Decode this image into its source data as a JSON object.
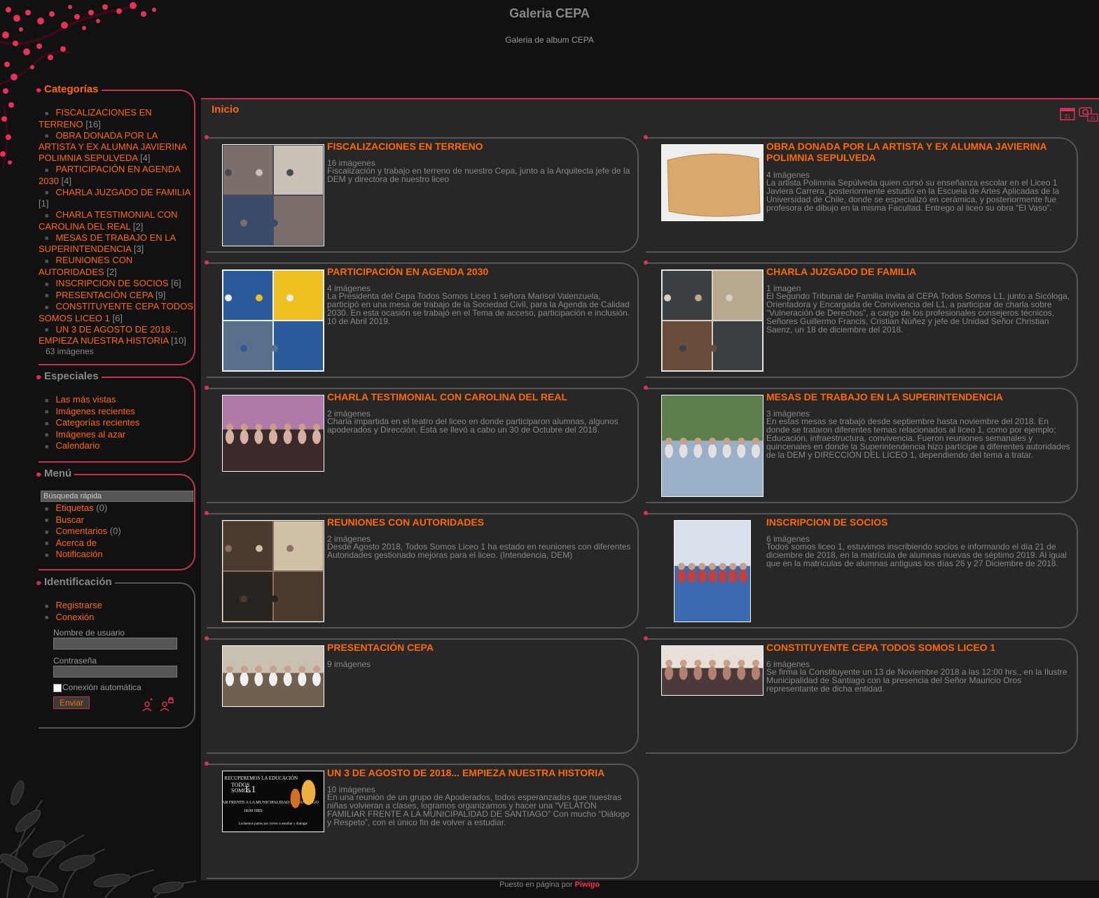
{
  "site": {
    "title": "Galeria CEPA",
    "subtitle": "Galeria de album CEPA"
  },
  "sidebar": {
    "categories": {
      "title": "Categorías",
      "items": [
        {
          "label": "FISCALIZACIONES EN TERRENO",
          "count": "[16]"
        },
        {
          "label": "OBRA DONADA POR LA ARTISTA Y EX ALUMNA JAVIERINA POLIMNIA SEPULVEDA",
          "count": "[4]"
        },
        {
          "label": "PARTICIPACIÓN EN AGENDA 2030",
          "count": "[4]"
        },
        {
          "label": "CHARLA JUZGADO DE FAMILIA",
          "count": "[1]"
        },
        {
          "label": "CHARLA TESTIMONIAL CON CAROLINA DEL REAL",
          "count": "[2]"
        },
        {
          "label": "MESAS DE TRABAJO EN LA SUPERINTENDENCIA",
          "count": "[3]"
        },
        {
          "label": "REUNIONES CON AUTORIDADES",
          "count": "[2]"
        },
        {
          "label": "INSCRIPCION DE SOCIOS",
          "count": "[6]"
        },
        {
          "label": "PRESENTACIÓN CEPA",
          "count": "[9]"
        },
        {
          "label": "CONSTITUYENTE CEPA TODOS SOMOS LICEO 1",
          "count": "[6]"
        },
        {
          "label": "UN 3 DE AGOSTO DE 2018... EMPIEZA NUESTRA HISTORIA",
          "count": "[10]"
        }
      ],
      "total": "63 imágenes"
    },
    "specials": {
      "title": "Especiales",
      "items": [
        "Las más vistas",
        "Imágenes recientes",
        "Categorías recientes",
        "Imágenes al azar",
        "Calendario"
      ]
    },
    "menu": {
      "title": "Menú",
      "search_placeholder": "Búsqueda rápida",
      "items": [
        {
          "label": "Etiquetas",
          "count": "(0)"
        },
        {
          "label": "Buscar",
          "count": ""
        },
        {
          "label": "Comentarios",
          "count": "(0)"
        },
        {
          "label": "Acerca de",
          "count": ""
        },
        {
          "label": "Notificación",
          "count": ""
        }
      ]
    },
    "identification": {
      "title": "Identificación",
      "items": [
        "Registrarse",
        "Conexión"
      ],
      "username_label": "Nombre de usuario",
      "password_label": "Contraseña",
      "remember_label": "Conexión automática",
      "submit_label": "Enviar"
    }
  },
  "content": {
    "breadcrumb": "Inicio",
    "albums": [
      {
        "title": "FISCALIZACIONES EN TERRENO",
        "count": "16 imágenes",
        "desc": "Fiscalización y trabajo en terreno de nuestro Cepa, junto a la Arquitecta jefe de la DEM y directora de nuestro liceo"
      },
      {
        "title": "OBRA DONADA POR LA ARTISTA Y EX ALUMNA JAVIERINA POLIMNIA SEPULVEDA",
        "count": "4 imágenes",
        "desc": "La artista Polimnia Sepúlveda quien cursó su enseñanza escolar en el Liceo 1 Javiera Carrera, posteriormente estudió en la Escuela de Artes Aplicadas de la Universidad de Chile, donde se especializó en cerámica, y posteriormente fue profesora de dibujo en la misma Facultad. Entrego al liceo su obra “El Vaso”."
      },
      {
        "title": "PARTICIPACIÓN EN AGENDA 2030",
        "count": "4 imágenes",
        "desc": "La Presidenta del Cepa Todos Somos Liceo 1 señora Marisol Valenzuela, participó en una mesa de trabajo de la Sociedad Civil, para la Agenda de Calidad 2030. En esta ocasión se trabajó en el Tema de acceso, participación e inclusión. 10 de Abril 2019."
      },
      {
        "title": "CHARLA JUZGADO DE FAMILIA",
        "count": "1 imagen",
        "desc": "El Segundo Tribunal de Familia invita al CEPA Todos Somos L1, junto a Sicóloga, Orientadora y Encargada de Convivencia del L1, a participar de charla sobre “Vulneración de Derechos”, a cargo de los profesionales consejeros técnicos, Señores Guillermo Francis, Cristian Núñez y jefe de Unidad Señor Christian Saenz, un 18 de diciembre del 2018."
      },
      {
        "title": "CHARLA TESTIMONIAL CON CAROLINA DEL REAL",
        "count": "2 imágenes",
        "desc": "Charla impartida en el teatro del liceo en donde participaron alumnas, algunos apoderados y Dirección. Está se llevó a cabo un 30 de Octubre del 2018."
      },
      {
        "title": "MESAS DE TRABAJO EN LA SUPERINTENDENCIA",
        "count": "3 imágenes",
        "desc": "En estas mesas se trabajó desde septiembre hasta noviembre del 2018. En donde se trataron diferentes temas relacionados al liceo 1, como por ejemplo; Educación, infraestructura, convivencia. Fueron reuniones semanales y quincenales en donde la Superintendencia hizo partícipe a diferentes autoridades de la DEM y DIRECCIÓN DEL LICEO 1, dependiendo del tema a tratar."
      },
      {
        "title": "REUNIONES CON AUTORIDADES",
        "count": "2 imágenes",
        "desc": "Desde Agosto 2018, Todos Somos Liceo 1 ha estado en reuniones con diferentes Autoridades gestionado mejoras para el liceo. (Intendencia, DEM)"
      },
      {
        "title": "INSCRIPCION DE SOCIOS",
        "count": "6 imágenes",
        "desc": "Todos somos liceo 1, estuvimos inscribiendo socios e informando el día 21 de diciembre de 2018, en la matrícula de alumnas nuevas de séptimo 2019. Al igual que en la matrículas de alumnas antiguas los días 26 y 27 Diciembre de 2018."
      },
      {
        "title": "PRESENTACIÓN CEPA",
        "count": "9 imágenes",
        "desc": ""
      },
      {
        "title": "CONSTITUYENTE CEPA TODOS SOMOS LICEO 1",
        "count": "6 imágenes",
        "desc": "Se firma la Constituyente un 13 de Noviembre 2018 a las 12:00 hrs., en la Ilustre Municipalidad de Santiago con la presencia del Señor Mauricio Oros representante de dicha entidad."
      },
      {
        "title": "UN 3 DE AGOSTO DE 2018... EMPIEZA NUESTRA HISTORIA",
        "count": "10 imágenes",
        "desc": "En una reunión de un grupo de Apoderados, todos esperanzados que nuestras niñas volvieran a clases, logramos organizarnos y hacer una “VELATÓN FAMILIAR FRENTE A LA MUNICIPALIDAD DE SANTIAGO” Con mucho “Diálogo y Respeto”, con el único fin de volver a estudiar."
      }
    ],
    "poster_text": {
      "line1": "RECUPEREMOS LA EDUCACIÓN",
      "line2": "TODOS",
      "line3": "SOMOS",
      "line4": "L1",
      "line5": "VELATÓN FAMILIAR FRENTE A LA MUNICIPALIDAD DE SANTIAGO",
      "line6": "18:00 HRS",
      "line7": "Luchemos juntos por volver a estudiar y dialogar"
    },
    "calendar_icon_text": "31"
  },
  "footer": {
    "prefix": "Puesto en página por",
    "brand": "Piwigo"
  },
  "colors": {
    "accent": "#ff6a00",
    "border": "#c2334d",
    "panel": "#272727"
  }
}
